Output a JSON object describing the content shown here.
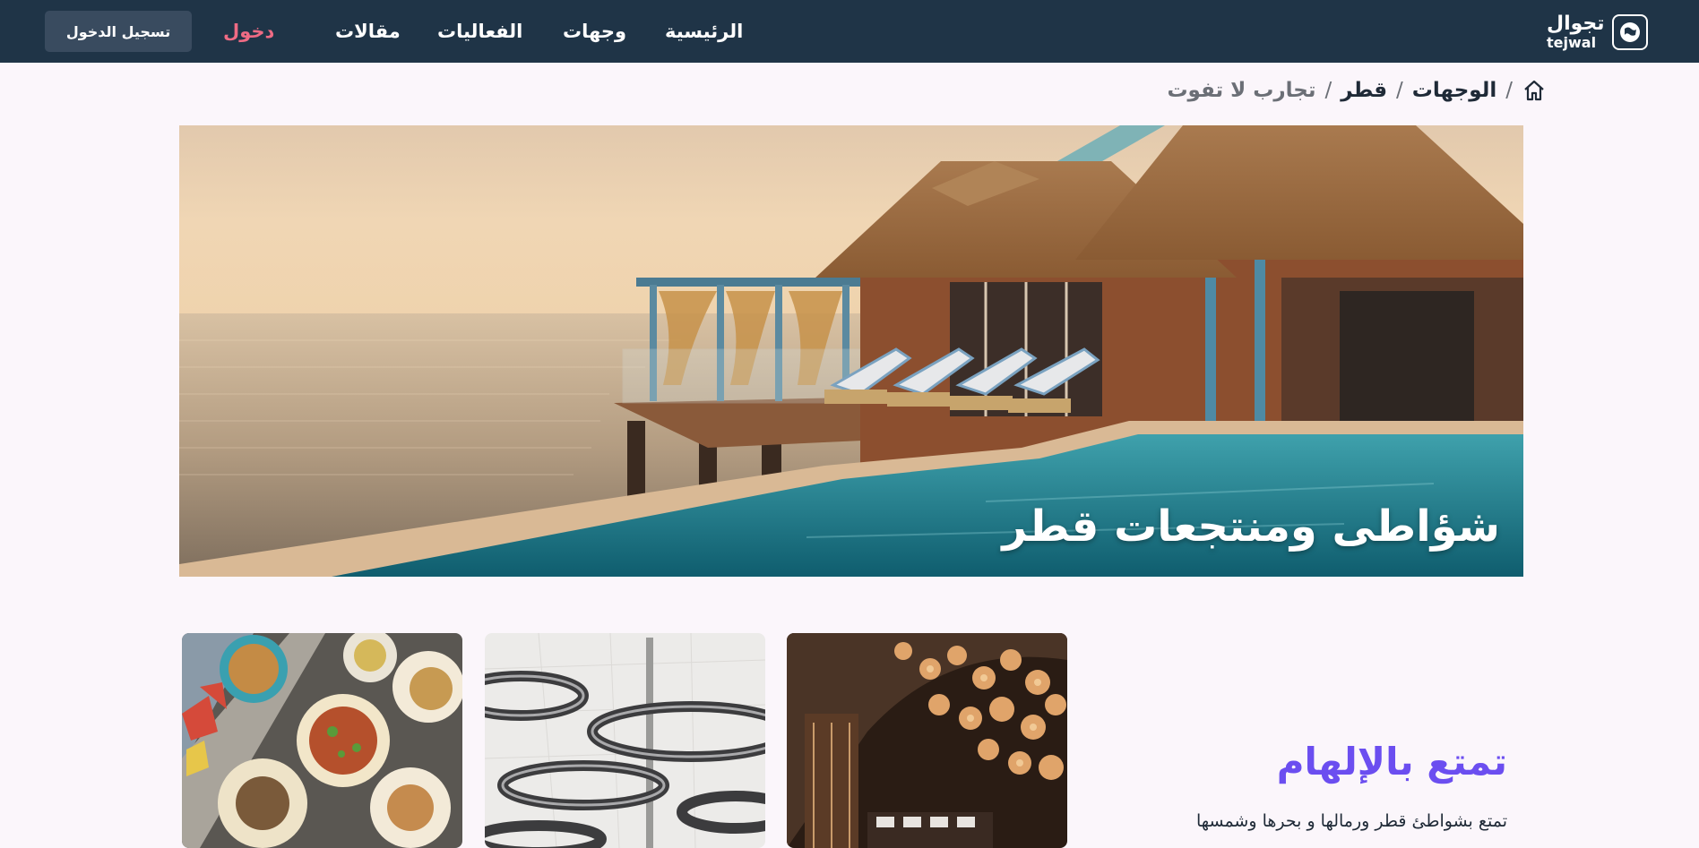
{
  "nav": {
    "logo_ar": "تجوال",
    "logo_en": "tejwal",
    "links": [
      "الرئيسية",
      "وجهات",
      "الفعاليات",
      "مقالات"
    ],
    "login": "دخول",
    "register": "تسجيل الدخول"
  },
  "breadcrumb": {
    "items": [
      "الوجهات",
      "قطر"
    ],
    "current": "تجارب لا تفوت",
    "separator": "/"
  },
  "hero": {
    "title": "شؤاطى ومنتجعات قطر"
  },
  "inspiration": {
    "title": "تمتع بالإلهام",
    "text": "تمتع بشواطئ قطر ورمالها و بحرها وشمسها"
  },
  "colors": {
    "nav_bg": "#1f3447",
    "accent_login": "#ee6b84",
    "accent_title": "#6b4ef0",
    "page_bg": "#fbf6fb"
  }
}
